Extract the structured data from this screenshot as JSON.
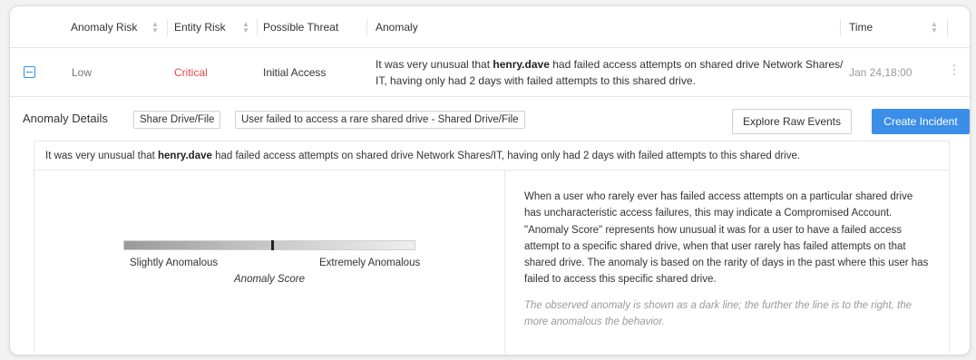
{
  "table": {
    "columns": [
      {
        "label": "Anomaly Risk",
        "sortable": true
      },
      {
        "label": "Entity Risk",
        "sortable": true
      },
      {
        "label": "Possible Threat",
        "sortable": false
      },
      {
        "label": "Anomaly",
        "sortable": false
      },
      {
        "label": "Time",
        "sortable": true
      }
    ],
    "row": {
      "anomaly_risk": "Low",
      "entity_risk": "Critical",
      "possible_threat": "Initial Access",
      "anomaly_pre": "It was very unusual that ",
      "anomaly_user": "henry.dave",
      "anomaly_post": " had failed access attempts on shared drive Network Shares/ IT, having only had 2 days with failed attempts to this shared drive.",
      "time": "Jan 24,18:00"
    }
  },
  "details": {
    "title": "Anomaly Details",
    "tags": [
      "Share Drive/File",
      "User failed to access a rare shared drive - Shared Drive/File"
    ],
    "explore_button": "Explore Raw Events",
    "create_button": "Create Incident",
    "summary_pre": "It was very unusual that ",
    "summary_user": "henry.dave",
    "summary_post": " had failed access attempts on shared drive Network Shares/IT, having only had 2 days with failed attempts to this shared drive.",
    "score": {
      "value_fraction": 0.51,
      "low_label": "Slightly Anomalous",
      "high_label": "Extremely Anomalous",
      "caption": "Anomaly Score"
    },
    "description": "When a user who rarely ever has failed access attempts on a particular shared drive has uncharacteristic access failures, this may indicate a Compromised Account. \"Anomaly Score\" represents how unusual it was for a user to have a failed access attempt to a specific shared drive, when that user rarely has failed attempts on that shared drive. The anomaly is based on the rarity of days in the past where this user has failed to access this specific shared drive.",
    "note": "The observed anomaly is shown as a dark line; the further the line is to the right, the more anomalous the behavior."
  },
  "colors": {
    "critical": "#e0454a",
    "primary": "#3b8ee8",
    "low": "#777777",
    "time": "#999999"
  },
  "icons": {
    "sort": "sort-arrows-icon",
    "collapse": "minus-square-icon",
    "row_menu": "vertical-dots-icon"
  }
}
